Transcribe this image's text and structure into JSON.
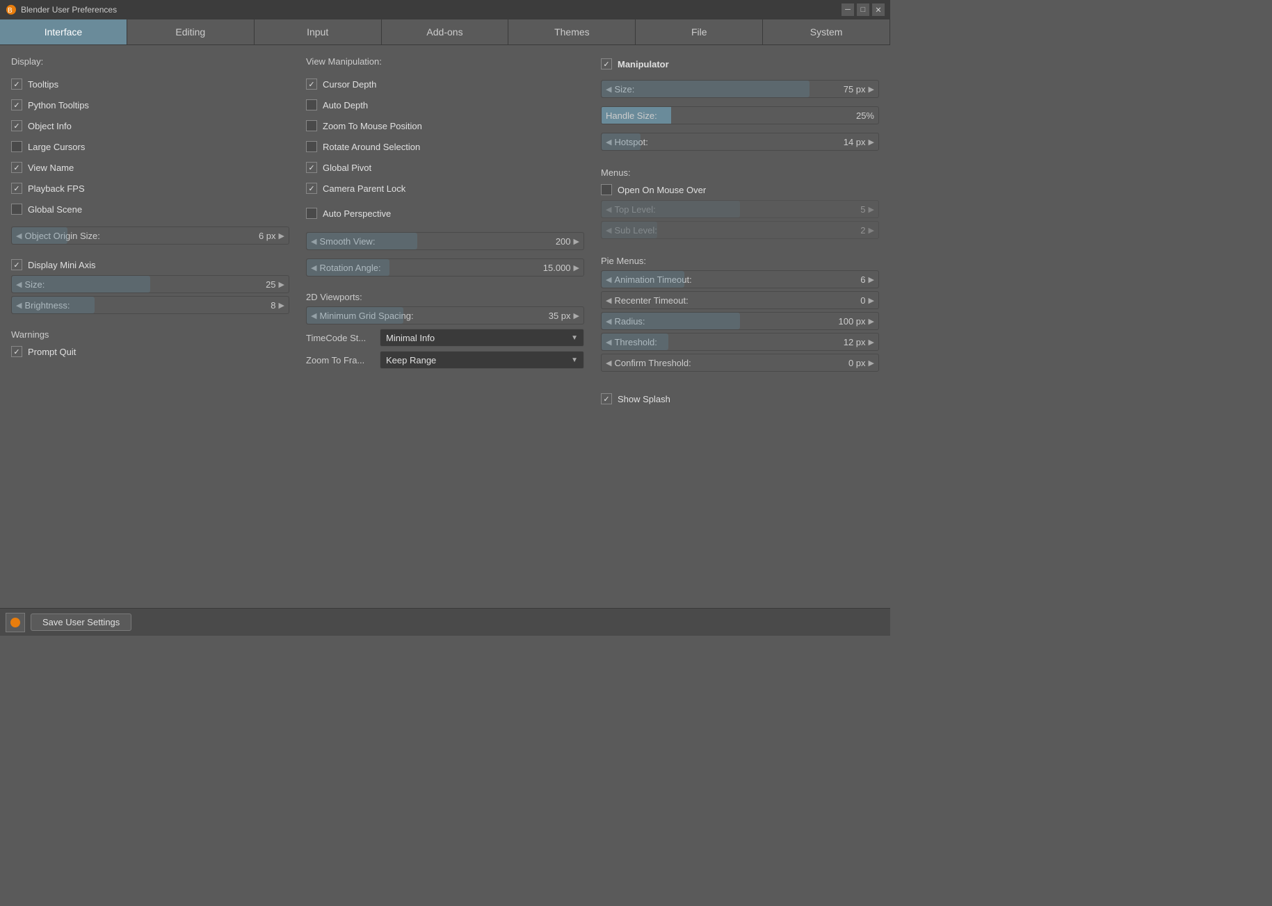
{
  "window": {
    "title": "Blender User Preferences"
  },
  "tabs": [
    {
      "label": "Interface",
      "active": true
    },
    {
      "label": "Editing",
      "active": false
    },
    {
      "label": "Input",
      "active": false
    },
    {
      "label": "Add-ons",
      "active": false
    },
    {
      "label": "Themes",
      "active": false
    },
    {
      "label": "File",
      "active": false
    },
    {
      "label": "System",
      "active": false
    }
  ],
  "display": {
    "title": "Display:",
    "items": [
      {
        "label": "Tooltips",
        "checked": true
      },
      {
        "label": "Python Tooltips",
        "checked": true
      },
      {
        "label": "Object Info",
        "checked": true
      },
      {
        "label": "Large Cursors",
        "checked": false
      },
      {
        "label": "View Name",
        "checked": true
      },
      {
        "label": "Playback FPS",
        "checked": true
      },
      {
        "label": "Global Scene",
        "checked": false
      }
    ],
    "object_origin_size": {
      "label": "Object Origin Size:",
      "value": "6 px",
      "fill_pct": 20
    },
    "mini_axis": {
      "label": "Display Mini Axis",
      "checked": true,
      "size": {
        "label": "Size:",
        "value": "25",
        "fill_pct": 50
      },
      "brightness": {
        "label": "Brightness:",
        "value": "8",
        "fill_pct": 30
      }
    },
    "warnings": {
      "title": "Warnings",
      "items": [
        {
          "label": "Prompt Quit",
          "checked": true
        }
      ]
    }
  },
  "view_manipulation": {
    "title": "View Manipulation:",
    "items": [
      {
        "label": "Cursor Depth",
        "checked": true
      },
      {
        "label": "Auto Depth",
        "checked": false
      },
      {
        "label": "Zoom To Mouse Position",
        "checked": false
      },
      {
        "label": "Rotate Around Selection",
        "checked": false
      },
      {
        "label": "Global Pivot",
        "checked": true
      },
      {
        "label": "Camera Parent Lock",
        "checked": true
      }
    ],
    "auto_perspective": {
      "label": "Auto Perspective",
      "checked": false
    },
    "smooth_view": {
      "label": "Smooth View:",
      "value": "200",
      "fill_pct": 40
    },
    "rotation_angle": {
      "label": "Rotation Angle:",
      "value": "15.000",
      "fill_pct": 30
    },
    "viewports_2d": {
      "title": "2D Viewports:",
      "min_grid": {
        "label": "Minimum Grid Spacing:",
        "value": "35 px",
        "fill_pct": 35
      },
      "timecode": {
        "label": "TimeCode St...",
        "value": "Minimal Info"
      },
      "zoom_frame": {
        "label": "Zoom To Fra...",
        "value": "Keep Range"
      }
    }
  },
  "manipulator": {
    "title": "Manipulator",
    "checked": true,
    "size": {
      "label": "Size:",
      "value": "75 px",
      "fill_pct": 75
    },
    "handle_size": {
      "label": "Handle Size:",
      "value": "25%",
      "fill_pct": 25
    },
    "hotspot": {
      "label": "Hotspot:",
      "value": "14 px",
      "fill_pct": 14
    }
  },
  "menus": {
    "title": "Menus:",
    "open_on_mouse": {
      "label": "Open On Mouse Over",
      "checked": false
    },
    "top_level": {
      "label": "Top Level:",
      "value": "5",
      "fill_pct": 50,
      "disabled": true
    },
    "sub_level": {
      "label": "Sub Level:",
      "value": "2",
      "fill_pct": 20,
      "disabled": true
    }
  },
  "pie_menus": {
    "title": "Pie Menus:",
    "animation_timeout": {
      "label": "Animation Timeout:",
      "value": "6",
      "fill_pct": 30
    },
    "recenter_timeout": {
      "label": "Recenter Timeout:",
      "value": "0",
      "fill_pct": 0
    },
    "radius": {
      "label": "Radius:",
      "value": "100 px",
      "fill_pct": 50
    },
    "threshold": {
      "label": "Threshold:",
      "value": "12 px",
      "fill_pct": 24
    },
    "confirm_threshold": {
      "label": "Confirm Threshold:",
      "value": "0 px",
      "fill_pct": 0
    }
  },
  "show_splash": {
    "label": "Show Splash",
    "checked": true
  },
  "bottom_bar": {
    "save_label": "Save User Settings"
  }
}
